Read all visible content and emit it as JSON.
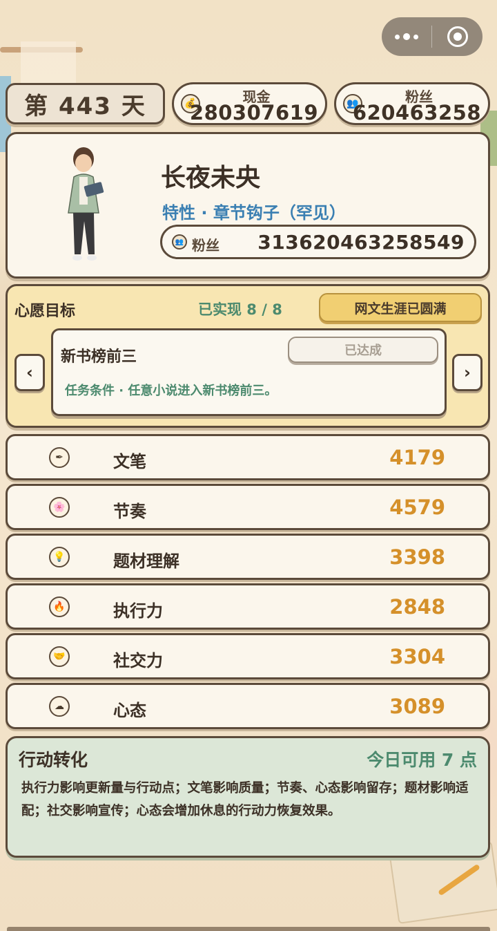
{
  "header": {
    "day_label": "第 443 天",
    "cash": {
      "label": "现金",
      "value": "280307619",
      "icon": "coin-bag-icon"
    },
    "fans": {
      "label": "粉丝",
      "value": "620463258",
      "icon": "fans-icon"
    }
  },
  "profile": {
    "name": "长夜未央",
    "trait": "特性 · 章节钩子（罕见）",
    "fans_label": "粉丝",
    "fans_value": "313620463258549",
    "avatar": "writer-character-avatar"
  },
  "wishes": {
    "title": "心愿目标",
    "progress": "已实现 8 / 8",
    "career_badge": "网文生涯已圆满",
    "current": {
      "title": "新书榜前三",
      "status": "已达成",
      "condition": "任务条件 · 任意小说进入新书榜前三。"
    },
    "prev_arrow": "‹",
    "next_arrow": "›"
  },
  "stats": [
    {
      "name": "文笔",
      "value": "4179",
      "icon": "pen-icon"
    },
    {
      "name": "节奏",
      "value": "4579",
      "icon": "rhythm-icon"
    },
    {
      "name": "题材理解",
      "value": "3398",
      "icon": "lightbulb-icon"
    },
    {
      "name": "执行力",
      "value": "2848",
      "icon": "fire-icon"
    },
    {
      "name": "社交力",
      "value": "3304",
      "icon": "handshake-icon"
    },
    {
      "name": "心态",
      "value": "3089",
      "icon": "mood-icon"
    }
  ],
  "action": {
    "title": "行动转化",
    "points": "今日可用 7 点",
    "description": "执行力影响更新量与行动点；文笔影响质量；节奏、心态影响留存；题材影响适配；社交影响宣传；心态会增加休息的行动力恢复效果。"
  },
  "colors": {
    "border": "#5b4a3a",
    "card": "#fbf6ec",
    "accent_orange": "#d5902a",
    "accent_green": "#4c8a6e",
    "accent_blue": "#3a7fb2",
    "wish_bg": "#f8e6b2",
    "action_bg": "#dce7d7"
  }
}
